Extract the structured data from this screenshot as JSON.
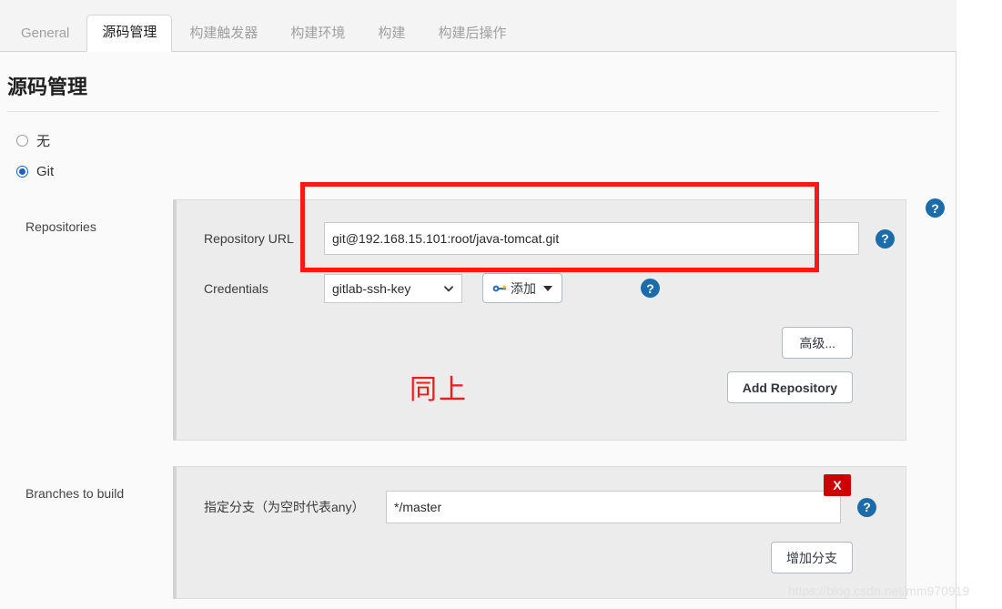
{
  "tabs": [
    {
      "label": "General",
      "active": false
    },
    {
      "label": "源码管理",
      "active": true
    },
    {
      "label": "构建触发器",
      "active": false
    },
    {
      "label": "构建环境",
      "active": false
    },
    {
      "label": "构建",
      "active": false
    },
    {
      "label": "构建后操作",
      "active": false
    }
  ],
  "page": {
    "title": "源码管理"
  },
  "scm_options": [
    {
      "label": "无",
      "selected": false
    },
    {
      "label": "Git",
      "selected": true
    }
  ],
  "repositories": {
    "section_label": "Repositories",
    "url_label": "Repository URL",
    "url_value": "git@192.168.15.101:root/java-tomcat.git",
    "credentials_label": "Credentials",
    "credentials_value": "gitlab-ssh-key",
    "add_credentials_label": "添加",
    "advanced_label": "高级...",
    "add_repository_label": "Add Repository"
  },
  "branches": {
    "section_label": "Branches to build",
    "specifier_label": "指定分支（为空时代表any）",
    "specifier_value": "*/master",
    "delete_label": "X",
    "add_branch_label": "增加分支"
  },
  "help": {
    "glyph": "?"
  },
  "annotations": {
    "note_text": "同上",
    "accent_color": "#fb1818"
  },
  "watermark": {
    "text": "https://blog.csdn.net/mm970919"
  }
}
